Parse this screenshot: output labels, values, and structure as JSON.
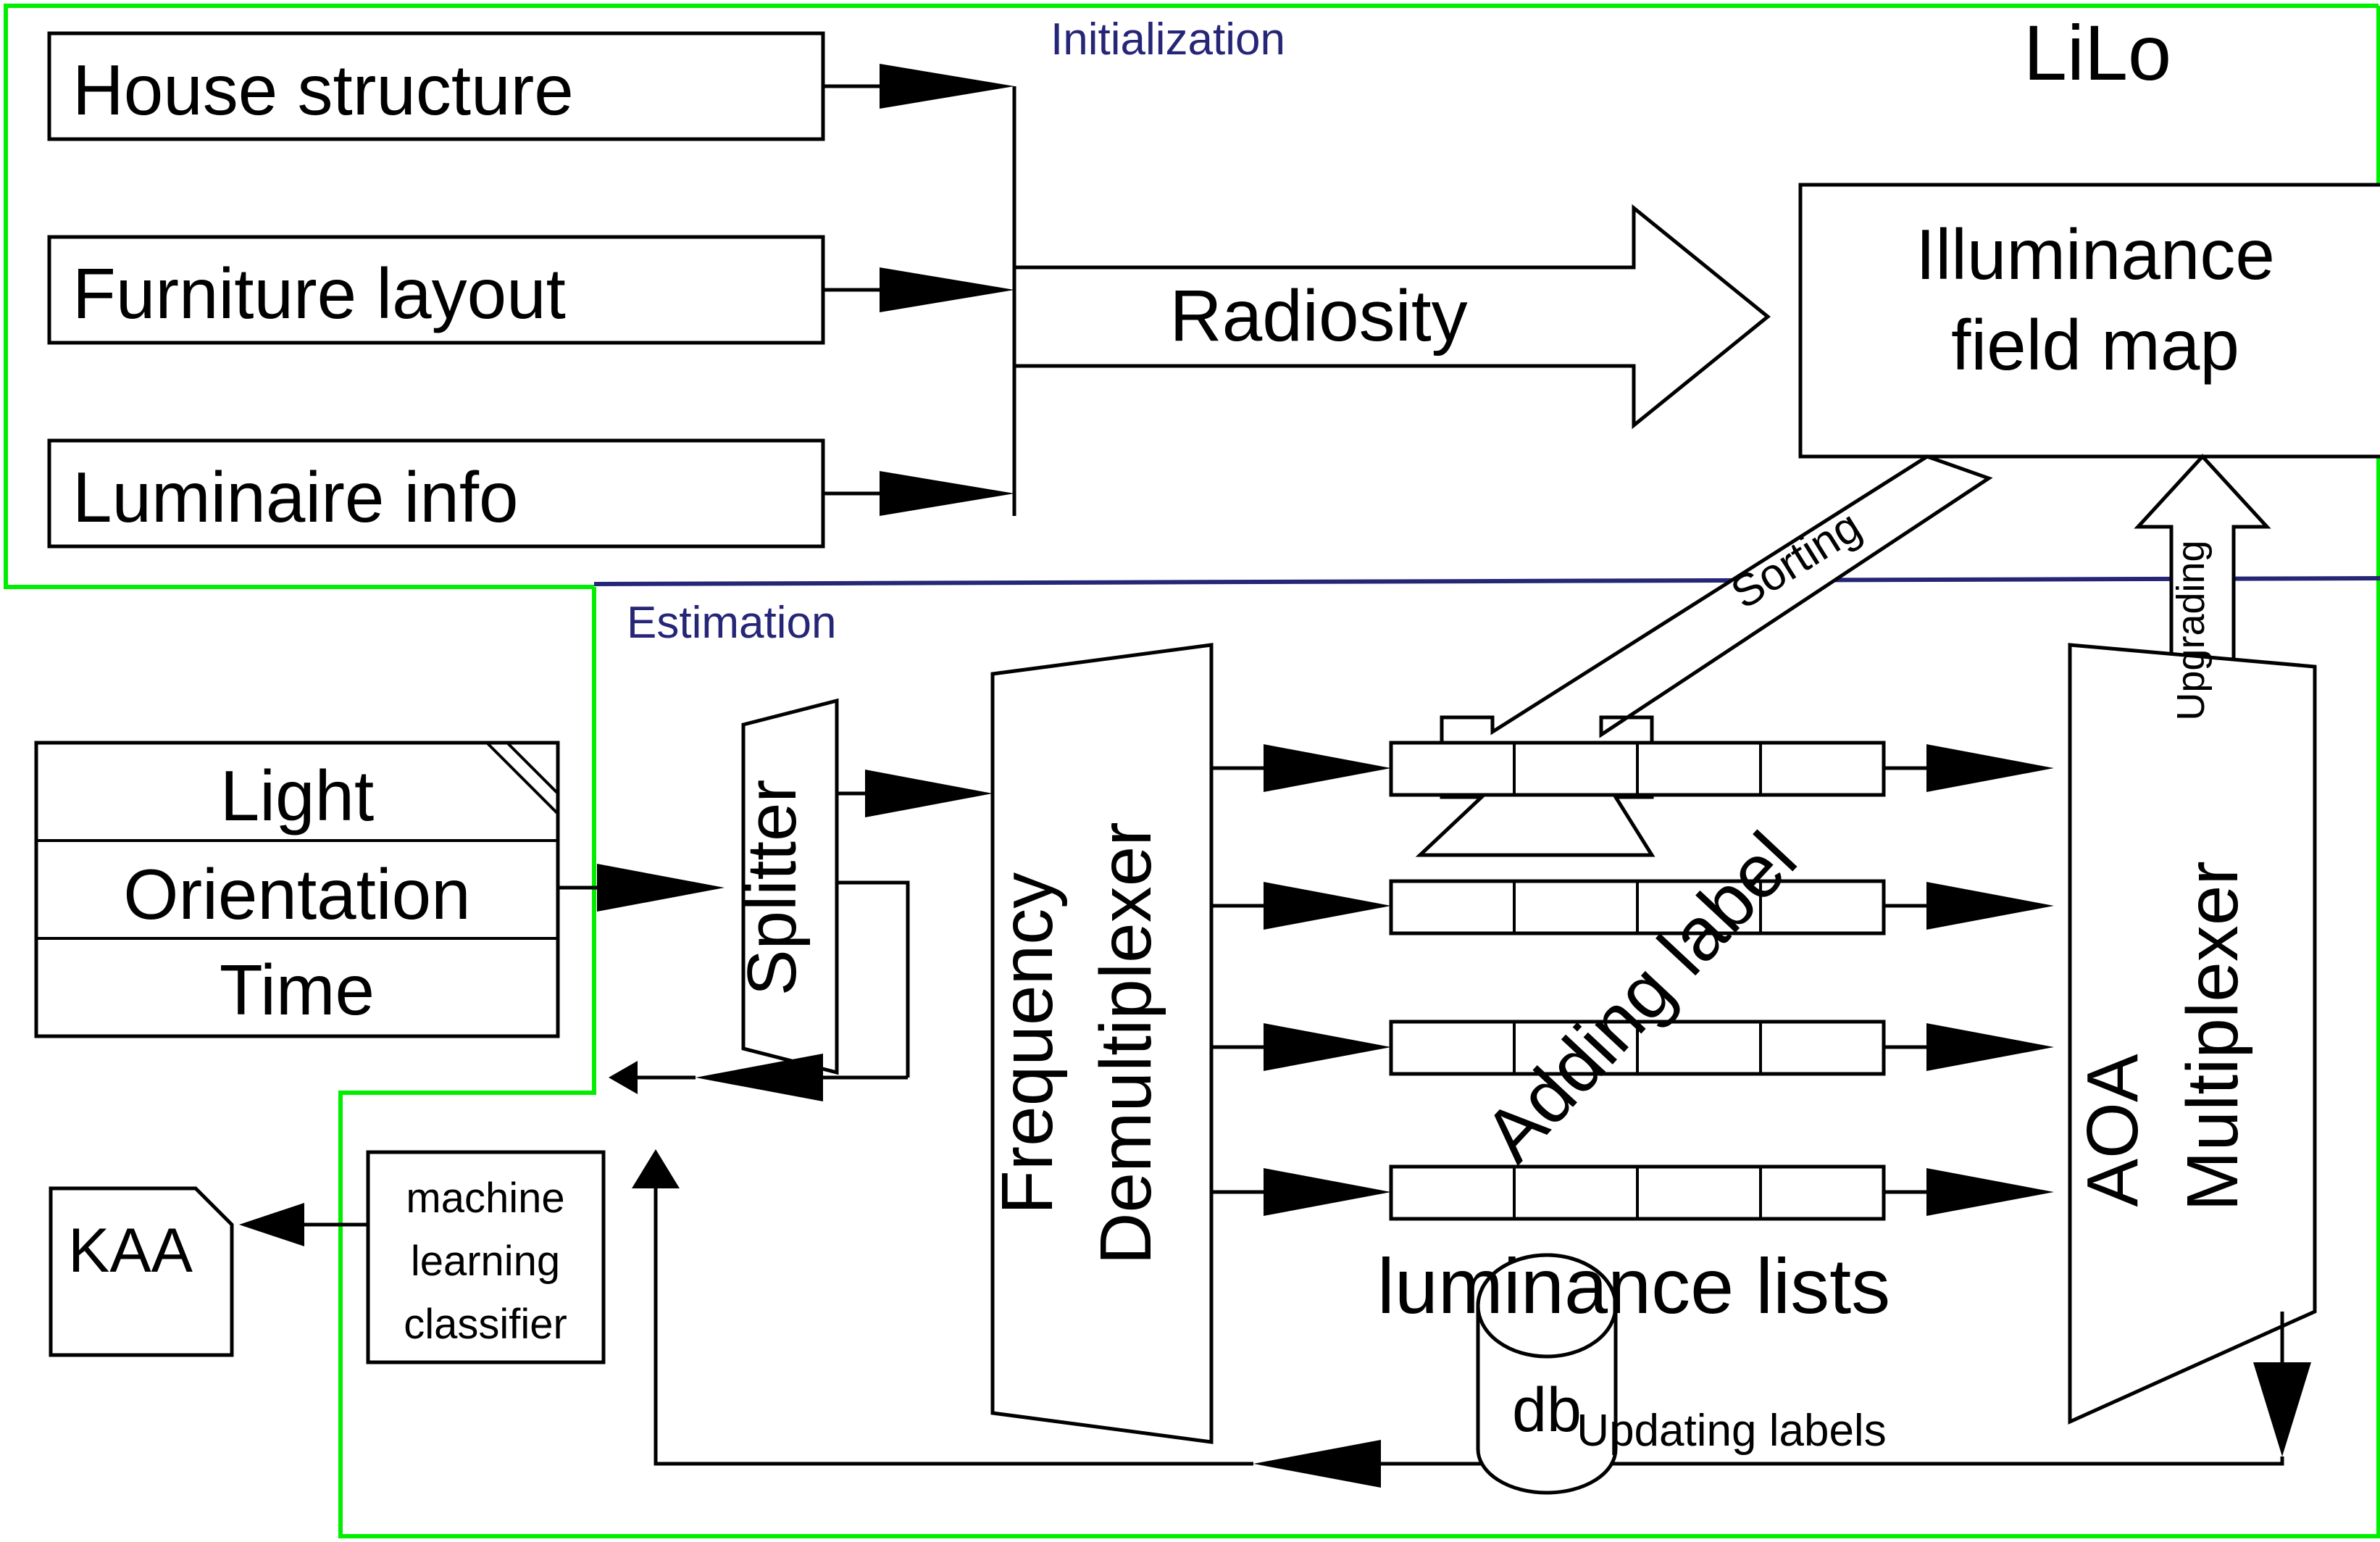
{
  "diagram": {
    "title": "LiLo",
    "phases": {
      "initialization": "Initialization",
      "estimation": "Estimation"
    },
    "colors": {
      "phase_label": "#262677",
      "phase_border_initialization": "#00ee00",
      "phase_border_estimation": "#00ee00",
      "divider": "#262677",
      "stroke": "#000000",
      "background": "#ffffff"
    }
  },
  "inputs": [
    {
      "label": "House structure"
    },
    {
      "label": "Furniture layout"
    },
    {
      "label": "Luminaire info"
    }
  ],
  "process": {
    "radiosity": "Radiosity",
    "sorting": "Sorting",
    "upgrading": "Upgrading",
    "adding_label": "Adding label",
    "updating_labels": "Updating labels"
  },
  "blocks": {
    "illuminance_field_map_line1": "Illuminance",
    "illuminance_field_map_line2": "field map",
    "splitter": "Splitter",
    "frequency_line1": "Frequency",
    "frequency_line2": "Demultiplexer",
    "aoa_line1": "AOA",
    "aoa_line2": "Multiplexer",
    "luminance_lists": "luminance lists",
    "database": "db",
    "kaa": "KAA",
    "classifier_line1": "machine",
    "classifier_line2": "learning",
    "classifier_line3": "classifier"
  },
  "sensor_box": {
    "rows": [
      {
        "label": "Light"
      },
      {
        "label": "Orientation"
      },
      {
        "label": "Time"
      }
    ]
  },
  "luminance_lists": {
    "count": 4,
    "cells_per_list": 4,
    "rows": [
      {
        "cells": [
          "",
          "",
          "",
          ""
        ]
      },
      {
        "cells": [
          "",
          "",
          "",
          ""
        ]
      },
      {
        "cells": [
          "",
          "",
          "",
          ""
        ]
      },
      {
        "cells": [
          "",
          "",
          "",
          ""
        ]
      }
    ]
  }
}
